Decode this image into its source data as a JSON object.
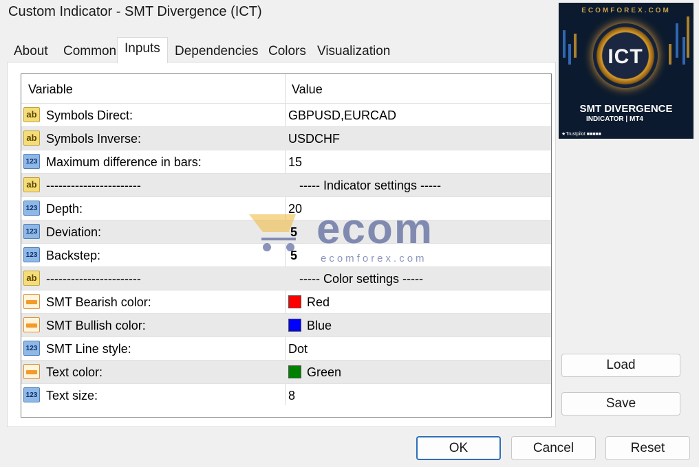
{
  "window": {
    "title": "Custom Indicator - SMT Divergence (ICT)"
  },
  "tabs": [
    "About",
    "Common",
    "Inputs",
    "Dependencies",
    "Colors",
    "Visualization"
  ],
  "grid": {
    "headers": {
      "variable": "Variable",
      "value": "Value"
    },
    "rows": [
      {
        "icon": "ab",
        "variable": "Symbols Direct:",
        "value": "GBPUSD,EURCAD"
      },
      {
        "icon": "123",
        "variable": "Symbols Inverse:",
        "value": "USDCHF"
      },
      {
        "icon": "123",
        "variable": "Maximum difference in bars:",
        "value": "15"
      },
      {
        "icon": "ab",
        "variable": "-----------------------",
        "value": "----- Indicator settings -----"
      },
      {
        "icon": "123",
        "variable": "Depth:",
        "value": "20"
      },
      {
        "icon": "123",
        "variable": "Deviation:",
        "value": "5"
      },
      {
        "icon": "123",
        "variable": "Backstep:",
        "value": "5"
      },
      {
        "icon": "ab",
        "variable": "-----------------------",
        "value": "----- Color settings -----"
      },
      {
        "icon": "color",
        "variable": "SMT Bearish color:",
        "value": "Red",
        "swatch": "#ff0000"
      },
      {
        "icon": "color",
        "variable": "SMT Bullish color:",
        "value": "Blue",
        "swatch": "#0000ff"
      },
      {
        "icon": "123",
        "variable": "SMT Line style:",
        "value": "Dot"
      },
      {
        "icon": "color",
        "variable": "Text color:",
        "value": "Green",
        "swatch": "#008000"
      },
      {
        "icon": "123",
        "variable": "Text size:",
        "value": "8"
      }
    ]
  },
  "thumbnail": {
    "site": "ECOMFOREX.COM",
    "logo_text": "ICT",
    "title": "SMT DIVERGENCE",
    "subtitle": "INDICATOR | MT4",
    "footer": "★Trustpilot ■■■■■"
  },
  "watermark": {
    "text": "ecom",
    "url": "ecomforex.com"
  },
  "buttons": {
    "load": "Load",
    "save": "Save",
    "ok": "OK",
    "cancel": "Cancel",
    "reset": "Reset"
  }
}
